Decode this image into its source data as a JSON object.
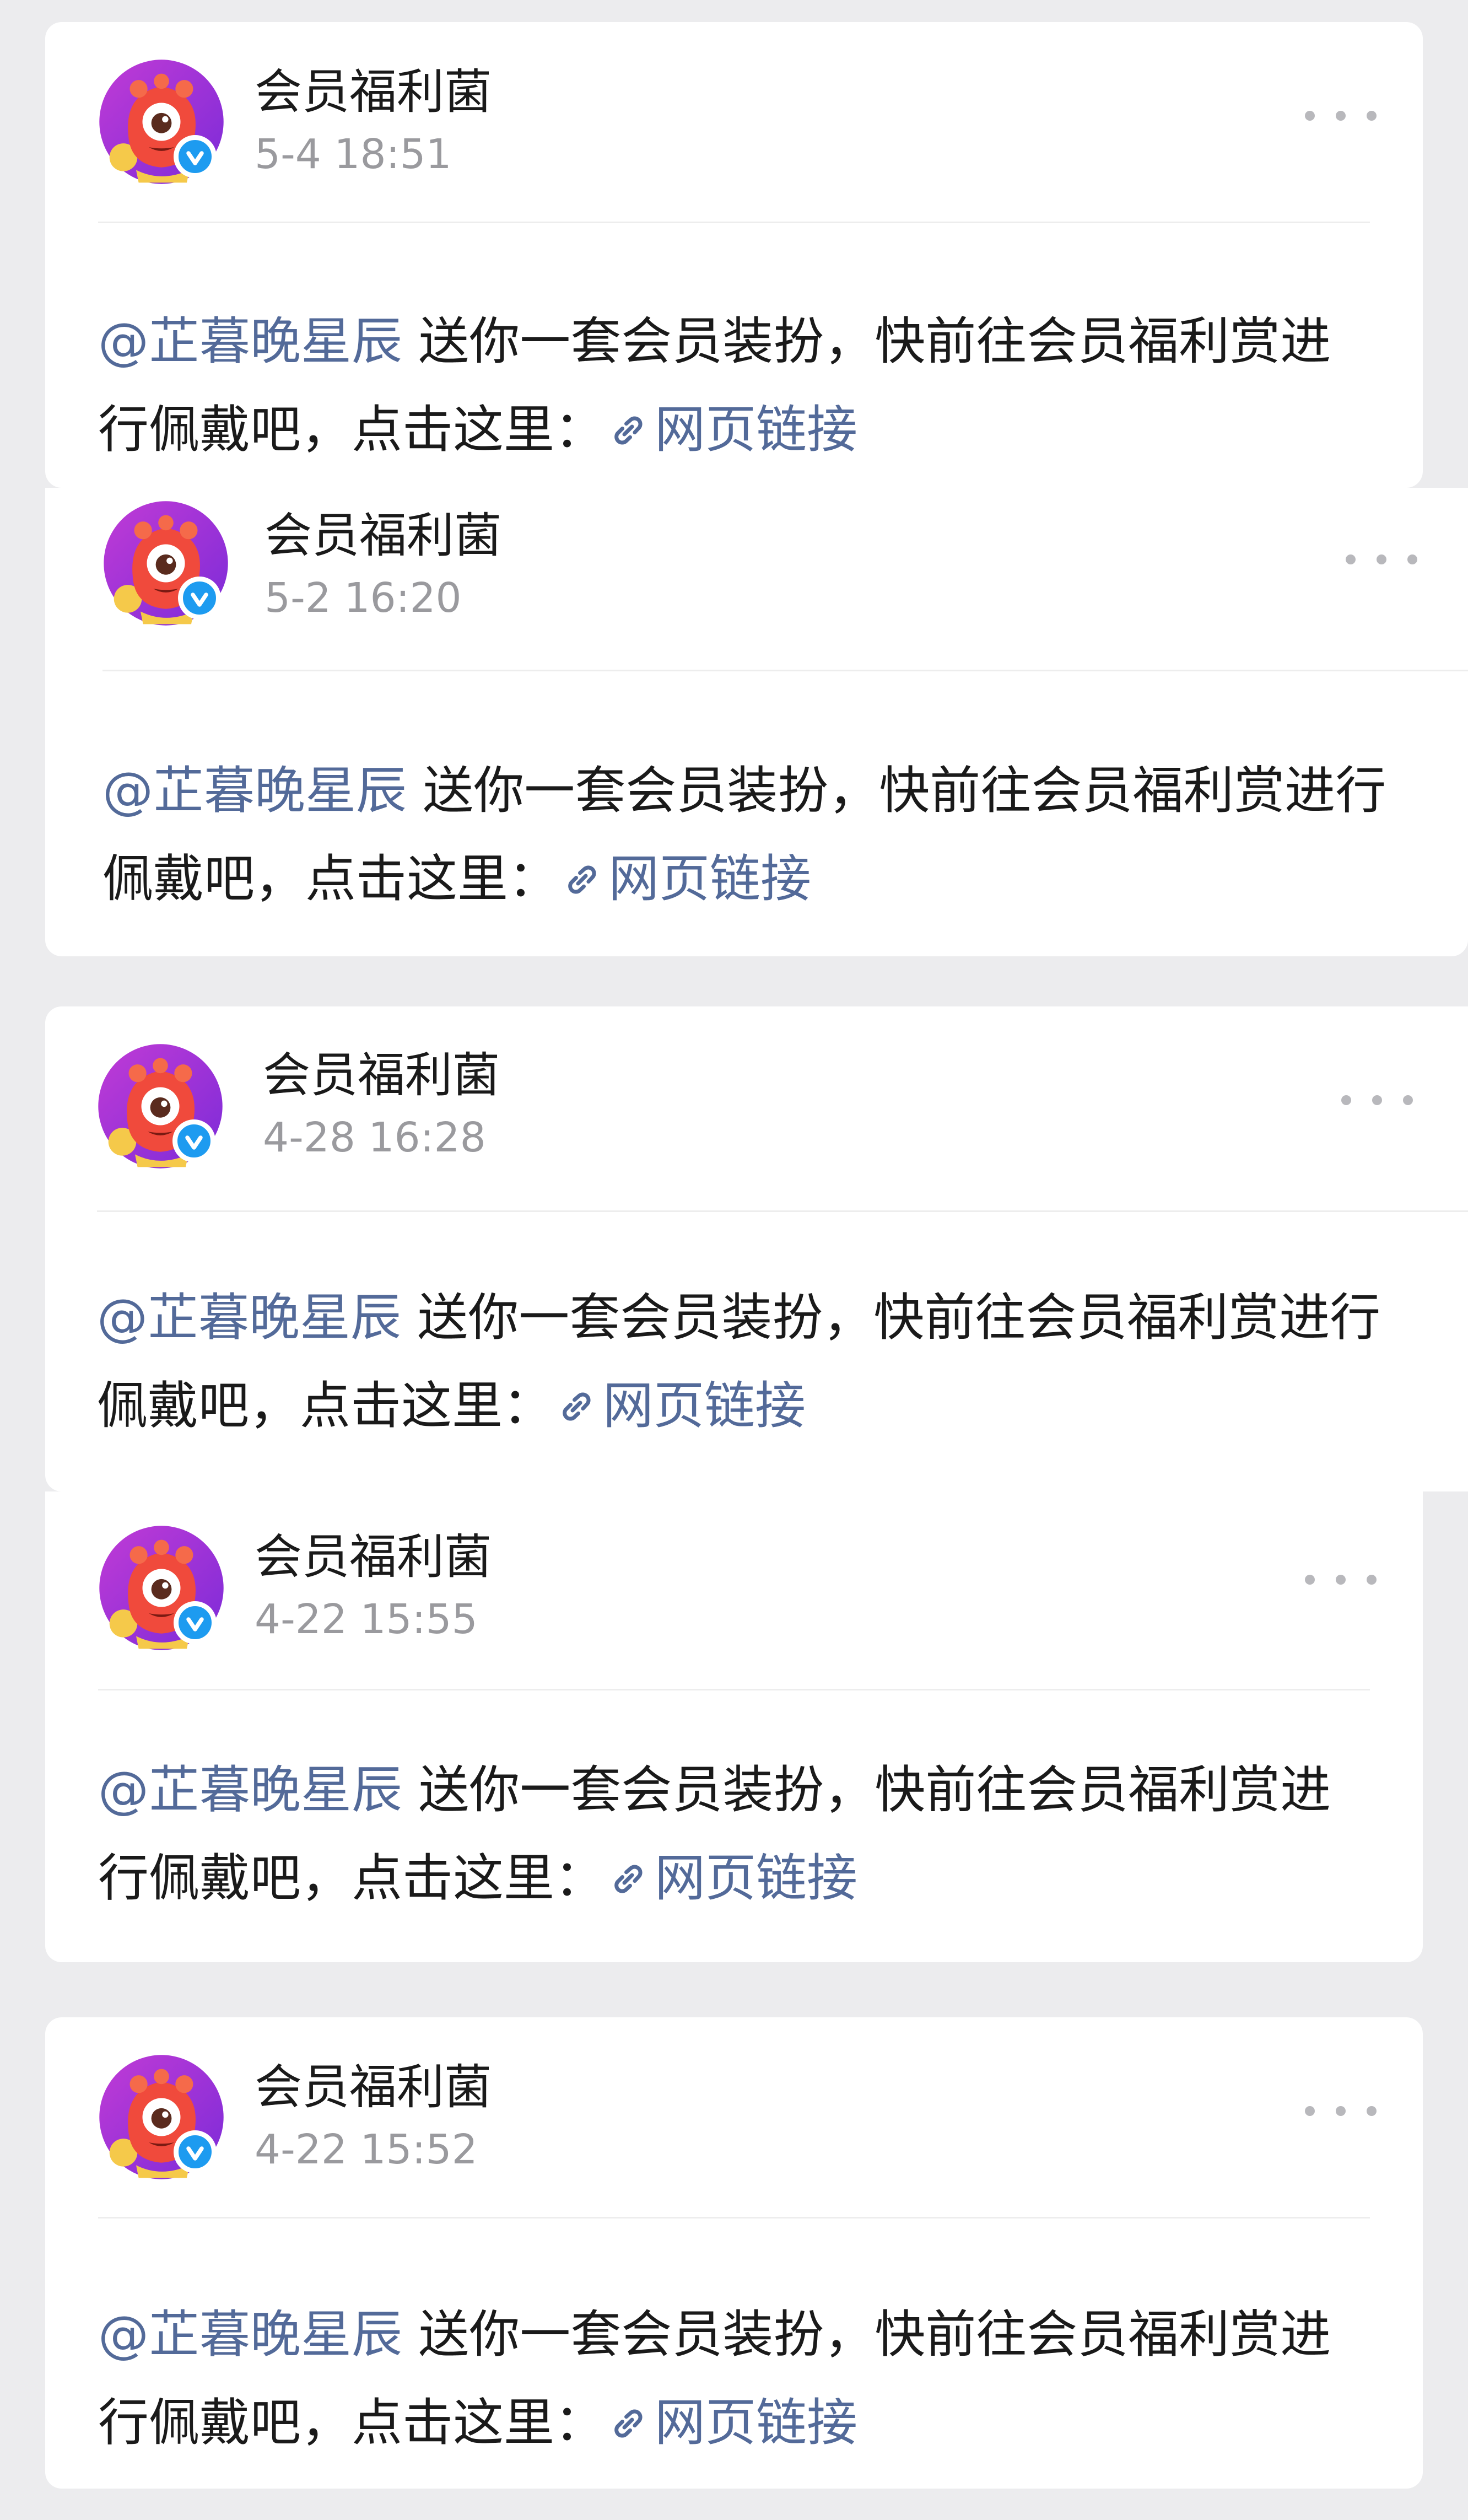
{
  "posts": [
    {
      "username": "会员福利菌",
      "time": "5-4 18:51",
      "mention": "@芷暮晚星辰",
      "message": " 送你一套会员装扮，快前往会员福利赏进行佩戴吧，点击这里：",
      "link_label": "网页链接"
    },
    {
      "username": "会员福利菌",
      "time": "5-2 16:20",
      "mention": "@芷暮晚星辰",
      "message": " 送你一套会员装扮，快前往会员福利赏进行佩戴吧，点击这里：",
      "link_label": "网页链接"
    },
    {
      "username": "会员福利菌",
      "time": "4-28 16:28",
      "mention": "@芷暮晚星辰",
      "message": " 送你一套会员装扮，快前往会员福利赏进行佩戴吧，点击这里：",
      "link_label": "网页链接"
    },
    {
      "username": "会员福利菌",
      "time": "4-22 15:55",
      "mention": "@芷暮晚星辰",
      "message": " 送你一套会员装扮，快前往会员福利赏进行佩戴吧，点击这里：",
      "link_label": "网页链接"
    },
    {
      "username": "会员福利菌",
      "time": "4-22 15:52",
      "mention": "@芷暮晚星辰",
      "message": " 送你一套会员装扮，快前往会员福利赏进行佩戴吧，点击这里：",
      "link_label": "网页链接"
    }
  ],
  "icons": {
    "avatar": "mascot-avatar",
    "verified": "verified-badge-icon",
    "more": "more-options-icon",
    "link": "link-icon"
  },
  "colors": {
    "background": "#ececee",
    "card": "#ffffff",
    "link": "#536a99",
    "text": "#1a1a1a",
    "muted": "#9a9a9e",
    "verified": "#1d9bf0"
  }
}
